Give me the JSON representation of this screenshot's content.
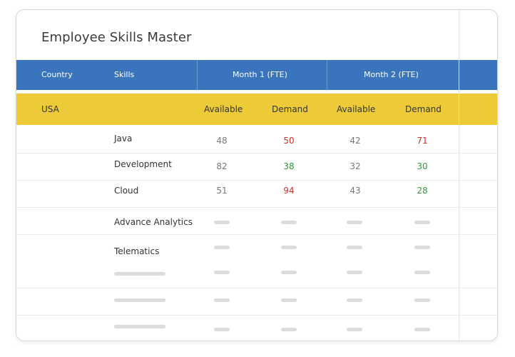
{
  "title": "Employee Skills Master",
  "header": {
    "country": "Country",
    "skills": "Skills",
    "month1": "Month 1 (FTE)",
    "month2": "Month 2 (FTE)"
  },
  "subheader": {
    "country": "USA",
    "available1": "Available",
    "demand1": "Demand",
    "available2": "Available",
    "demand2": "Demand"
  },
  "rows": [
    {
      "skill": "Java",
      "m1_available": "48",
      "m1_demand": "50",
      "m2_available": "42",
      "m2_demand": "71"
    },
    {
      "skill": "Development",
      "m1_available": "82",
      "m1_demand": "38",
      "m2_available": "32",
      "m2_demand": "30"
    },
    {
      "skill": "Cloud",
      "m1_available": "51",
      "m1_demand": "94",
      "m2_available": "43",
      "m2_demand": "28"
    },
    {
      "skill": "Advance Analytics"
    },
    {
      "skill": "Telematics"
    }
  ],
  "colors": {
    "header_blue": "#3a74bd",
    "subheader_yellow": "#ecca38",
    "demand_over": "#d62b2b",
    "demand_under": "#2e9b3c"
  }
}
